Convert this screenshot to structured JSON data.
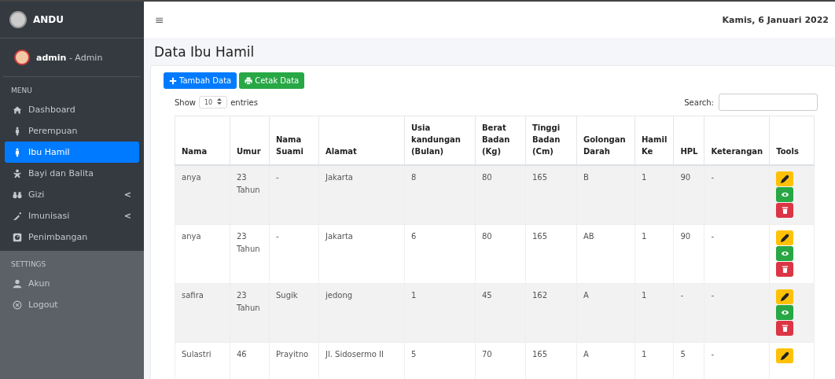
{
  "brand": {
    "title": "ANDU"
  },
  "user": {
    "name": "admin",
    "role": "- Admin"
  },
  "sidebar": {
    "sections": [
      {
        "heading": "MENU",
        "items": [
          {
            "label": "Dashboard",
            "kind": "home",
            "selected": false
          },
          {
            "label": "Perempuan",
            "kind": "woman",
            "selected": false
          },
          {
            "label": "Ibu Hamil",
            "kind": "woman",
            "selected": true
          },
          {
            "label": "Bayi dan Balita",
            "kind": "baby",
            "selected": false
          },
          {
            "label": "Gizi",
            "kind": "food",
            "selected": false,
            "submenu": "<"
          },
          {
            "label": "Imunisasi",
            "kind": "syringe",
            "selected": false,
            "submenu": "<"
          },
          {
            "label": "Penimbangan",
            "kind": "scale",
            "selected": false
          }
        ]
      },
      {
        "heading": "SETTINGS",
        "items": [
          {
            "label": "Akun",
            "kind": "user",
            "selected": false
          },
          {
            "label": "Logout",
            "kind": "logout",
            "selected": false
          }
        ]
      }
    ]
  },
  "topbar": {
    "menu_glyph": "≡",
    "date": "Kamis, 6 Januari 2022"
  },
  "page_title": "Data Ibu Hamil",
  "buttons": [
    {
      "label": "Tambah Data",
      "kind": "add"
    },
    {
      "label": "Cetak Data",
      "kind": "print"
    }
  ],
  "length": {
    "before": "Show",
    "value": "10",
    "after": "entries"
  },
  "search": {
    "label": "Search:"
  },
  "table": {
    "columns": [
      "Nama",
      "Umur",
      "Nama Suami",
      "Alamat",
      "Usia kandungan (Bulan)",
      "Berat Badan (Kg)",
      "Tinggi Badan (Cm)",
      "Golongan Darah",
      "Hamil Ke",
      "HPL",
      "Keterangan",
      "Tools"
    ],
    "rows": [
      {
        "cells": [
          "anya",
          "23 Tahun",
          "-",
          "Jakarta",
          "8",
          "80",
          "165",
          "B",
          "1",
          "90",
          "-"
        ],
        "tools": [
          {
            "kind": "edit"
          },
          {
            "kind": "view"
          },
          {
            "kind": "delete"
          }
        ]
      },
      {
        "cells": [
          "anya",
          "23 Tahun",
          "-",
          "Jakarta",
          "6",
          "80",
          "165",
          "AB",
          "1",
          "90",
          "-"
        ],
        "tools": [
          {
            "kind": "edit"
          },
          {
            "kind": "view"
          },
          {
            "kind": "delete"
          }
        ]
      },
      {
        "cells": [
          "safira",
          "23 Tahun",
          "Sugik",
          "jedong",
          "1",
          "45",
          "162",
          "A",
          "1",
          "-",
          "-"
        ],
        "tools": [
          {
            "kind": "edit"
          },
          {
            "kind": "view"
          },
          {
            "kind": "delete"
          }
        ]
      },
      {
        "cells": [
          "Sulastri",
          "46",
          "Prayitno",
          "Jl. Sidosermo II",
          "5",
          "70",
          "165",
          "A",
          "1",
          "5",
          "-"
        ],
        "tools": [
          {
            "kind": "edit"
          }
        ]
      }
    ]
  }
}
